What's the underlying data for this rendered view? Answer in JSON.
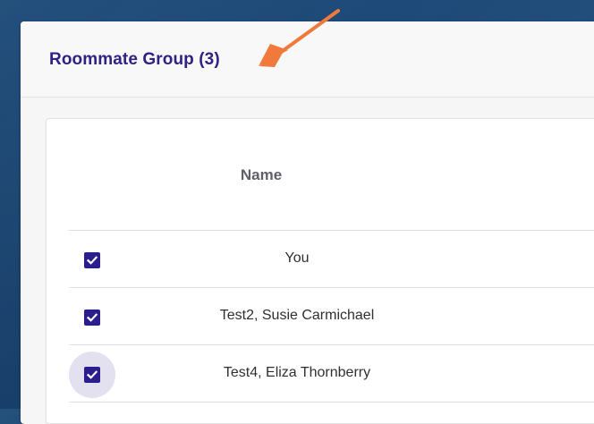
{
  "group": {
    "title": "Roommate Group (3)"
  },
  "table": {
    "columns": [
      "Name"
    ],
    "rows": [
      {
        "name": "You",
        "checked": true
      },
      {
        "name": "Test2, Susie Carmichael",
        "checked": true
      },
      {
        "name": "Test4, Eliza Thornberry",
        "checked": true
      }
    ]
  },
  "colors": {
    "title": "#2e2382",
    "checkbox": "#2a1e8c",
    "arrow": "#f07a3c",
    "background": "#1b4470"
  },
  "icons": {
    "checkbox_checked": "check-icon",
    "annotation": "arrow-icon"
  }
}
